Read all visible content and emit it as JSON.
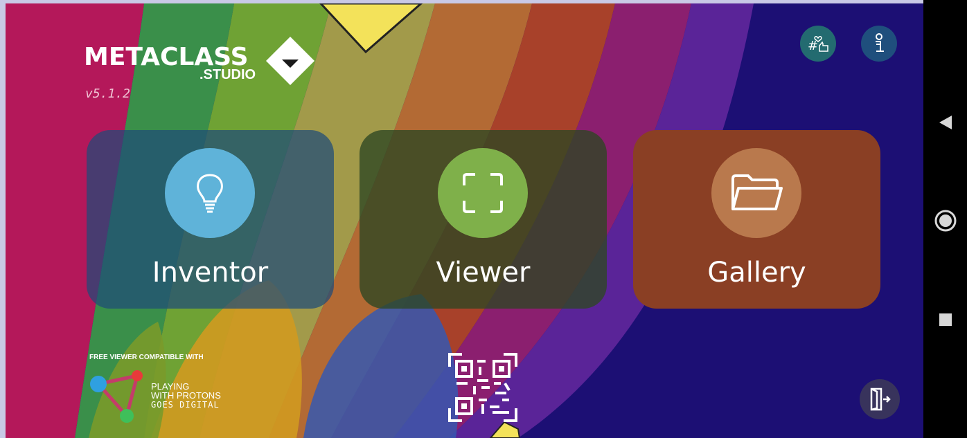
{
  "app": {
    "logo_text": "METACLASS",
    "logo_sub": ".STUDIO",
    "version": "v5.1.2"
  },
  "cards": [
    {
      "label": "Inventor",
      "icon": "lightbulb-icon",
      "color": "#5fb3d9"
    },
    {
      "label": "Viewer",
      "icon": "scan-frame-icon",
      "color": "#7fb04a"
    },
    {
      "label": "Gallery",
      "icon": "folder-icon",
      "color": "#b9794d"
    }
  ],
  "top_icons": [
    {
      "icon": "hashtag-like-icon",
      "color": "#2a7a8a"
    },
    {
      "icon": "info-icon",
      "color": "#1f5c8a"
    }
  ],
  "footer": {
    "compat_text": "FREE VIEWER COMPATIBLE WITH",
    "pwp_line1": "PLAYING",
    "pwp_line2": "WITH PROTONS",
    "pwp_line3": "GOES DIGITAL",
    "qr_icon": "qr-code-icon",
    "exit_icon": "exit-door-icon"
  },
  "system_nav": {
    "back": "back-triangle-icon",
    "home": "home-circle-icon",
    "recents": "recents-square-icon"
  }
}
